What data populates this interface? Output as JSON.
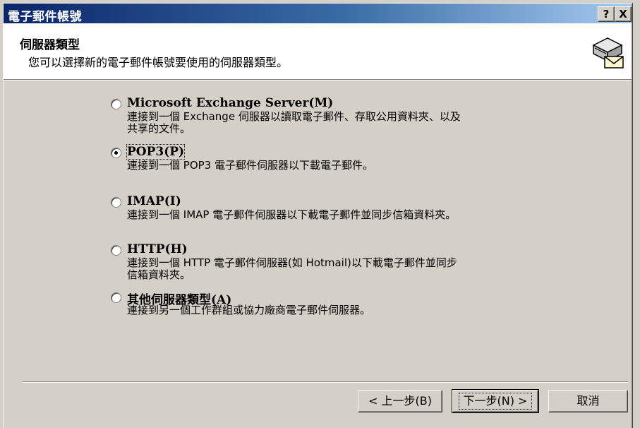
{
  "window": {
    "title": "電子郵件帳號",
    "help_button": "?",
    "close_button": "X"
  },
  "header": {
    "title": "伺服器類型",
    "subtitle": "您可以選擇新的電子郵件帳號要使用的伺服器類型。",
    "icon": "mail-server-icon"
  },
  "options": [
    {
      "label": "Microsoft Exchange Server(M)",
      "description": "連接到一個 Exchange 伺服器以讀取電子郵件、存取公用資料夾、以及\n共享的文件。",
      "selected": false
    },
    {
      "label": "POP3(P)",
      "description": "連接到一個 POP3 電子郵件伺服器以下載電子郵件。",
      "selected": true
    },
    {
      "label": "IMAP(I)",
      "description": "連接到一個 IMAP 電子郵件伺服器以下載電子郵件並同步信箱資料夾。",
      "selected": false
    },
    {
      "label": "HTTP(H)",
      "description": "連接到一個 HTTP 電子郵件伺服器(如 Hotmail)以下載電子郵件並同步\n信箱資料夾。",
      "selected": false
    },
    {
      "label": "其他伺服器類型(A)",
      "description": "連接到另一個工作群組或協力廠商電子郵件伺服器。",
      "selected": false
    }
  ],
  "buttons": {
    "back": "< 上一步(B)",
    "next": "下一步(N) >",
    "cancel": "取消"
  }
}
